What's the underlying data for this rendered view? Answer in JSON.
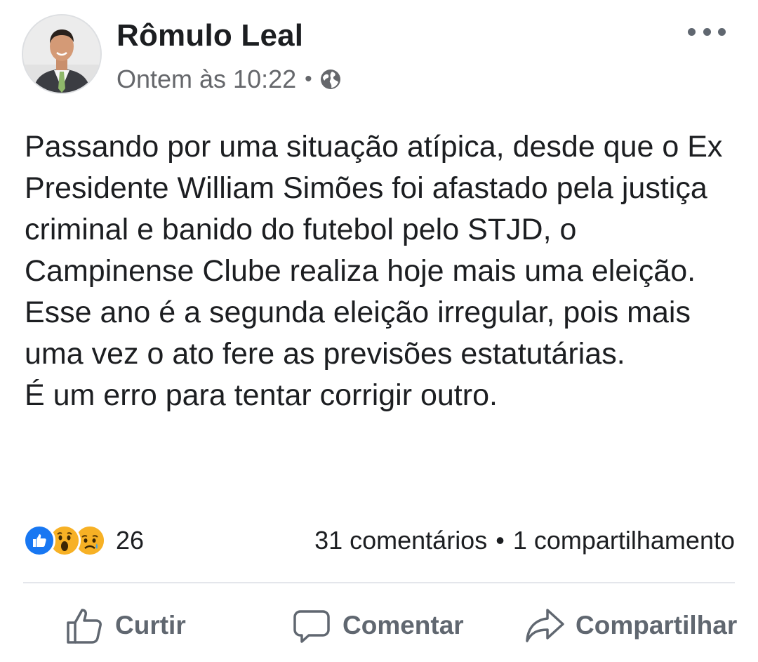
{
  "post": {
    "author": "Rômulo Leal",
    "timestamp": "Ontem às 10:22",
    "separator": "•",
    "privacy_icon": "globe-icon",
    "more_icon": "more-options-icon",
    "body": [
      "Passando por uma situação atípica, desde que o Ex Presidente William Simões foi afastado pela justiça criminal e banido do futebol pelo STJD, o Campinense Clube realiza hoje mais uma eleição.",
      "Esse ano é a segunda eleição irregular, pois mais uma vez o ato fere as previsões estatutárias.",
      "É um erro para tentar corrigir outro."
    ]
  },
  "reactions": {
    "icons": [
      "like-reaction-icon",
      "wow-reaction-icon",
      "sad-reaction-icon"
    ],
    "count": "26"
  },
  "stats": {
    "comments": "31 comentários",
    "separator": "•",
    "shares": "1 compartilhamento"
  },
  "actions": {
    "like": "Curtir",
    "comment": "Comentar",
    "share": "Compartilhar"
  },
  "colors": {
    "text": "#1c1e21",
    "secondary": "#65676b",
    "action": "#606770",
    "like_blue": "#1877f2",
    "emoji_yellow": "#f7b125",
    "divider": "#e4e6eb"
  }
}
